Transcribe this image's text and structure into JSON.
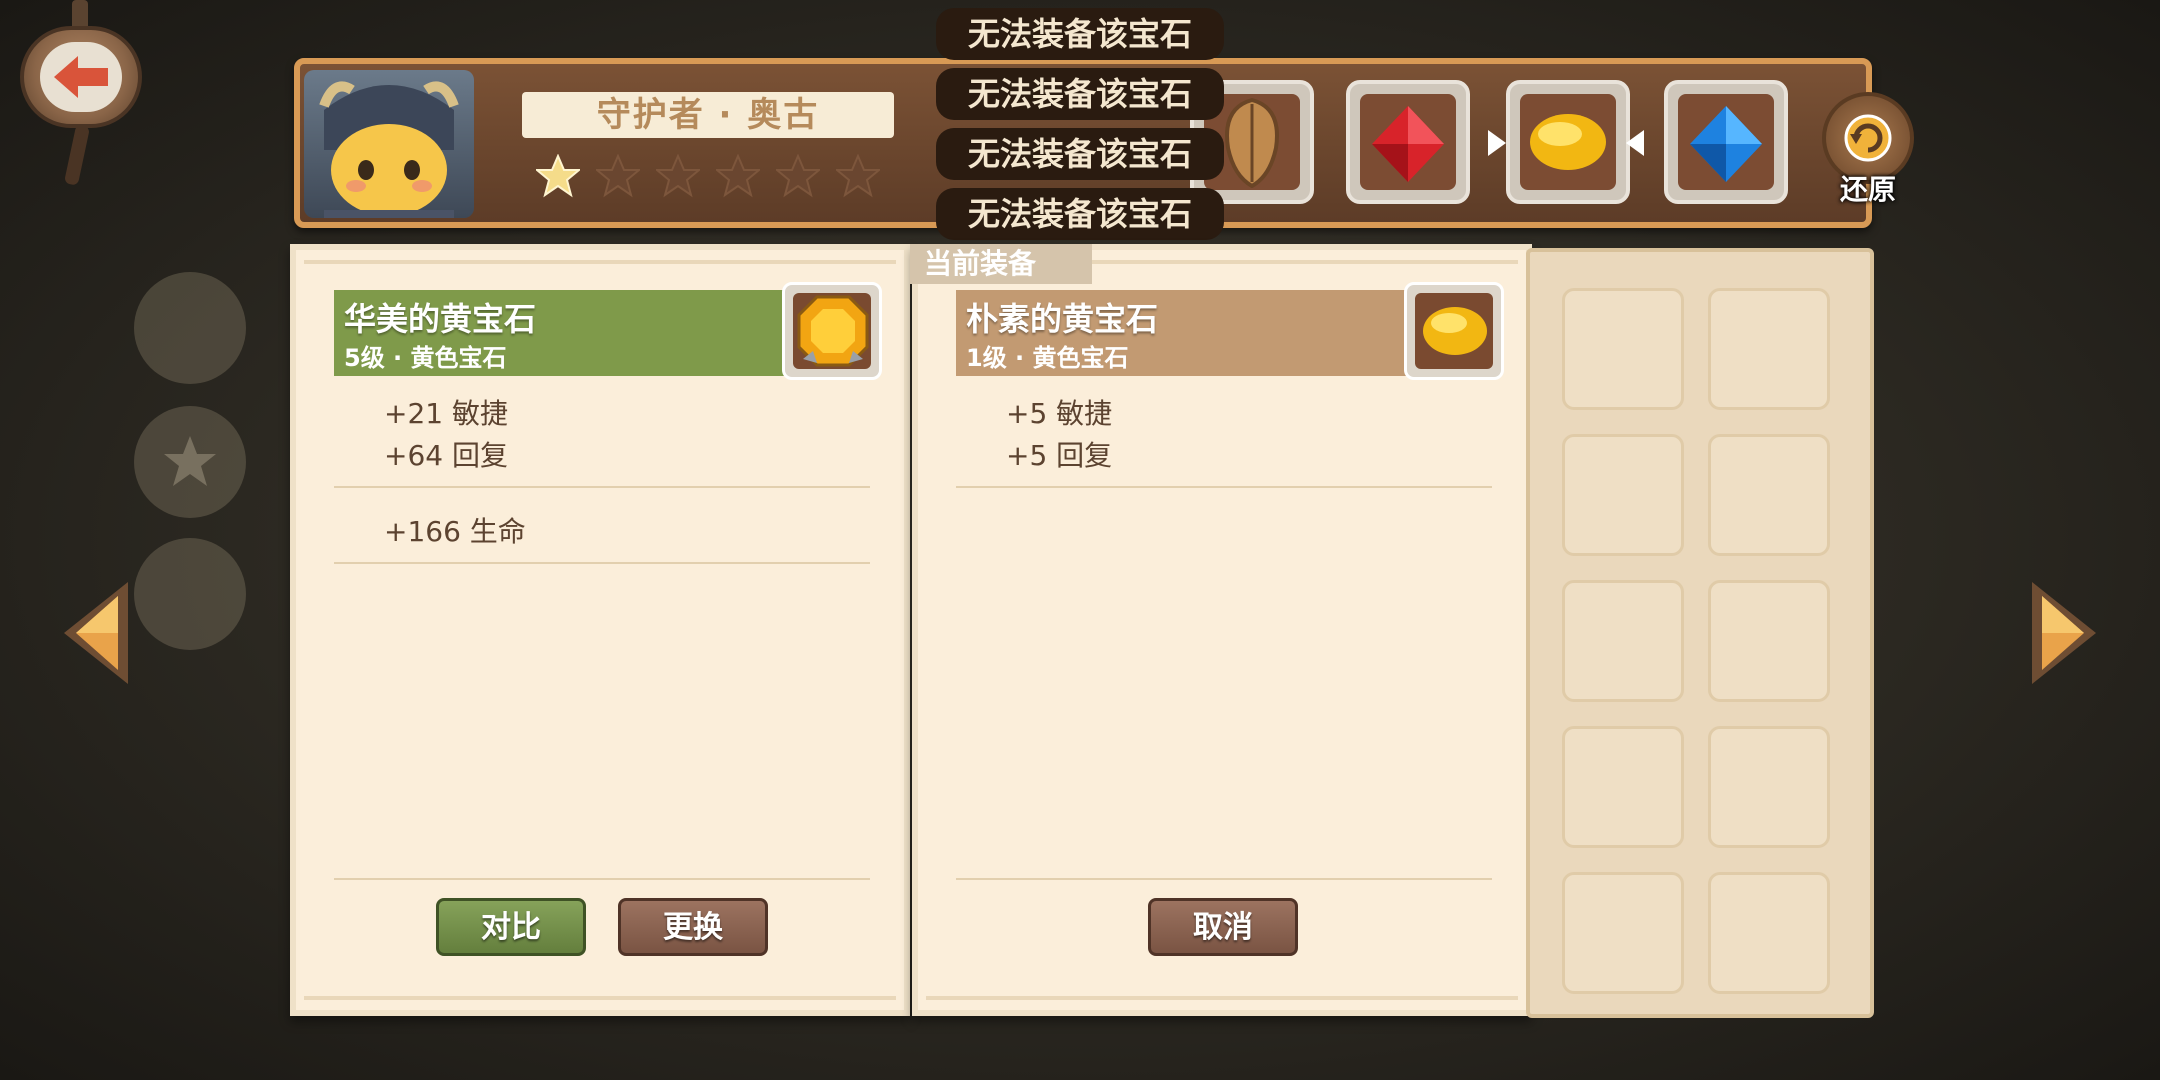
{
  "hero": {
    "name": "守护者 · 奥古",
    "stars_filled": 1,
    "stars_total": 6
  },
  "toasts": [
    "无法装备该宝石",
    "无法装备该宝石",
    "无法装备该宝石",
    "无法装备该宝石"
  ],
  "header": {
    "restore_label": "还原",
    "gem_slots": [
      "shield-icon",
      "red-gem-icon",
      "yellow-gem-icon",
      "blue-gem-icon"
    ]
  },
  "left_panel": {
    "name": "华美的黄宝石",
    "sub": "5级 · 黄色宝石",
    "banner_color": "#7f9a4a",
    "stats": [
      "+21  敏捷",
      "+64  回复"
    ],
    "extra_stats": [
      "+166  生命"
    ],
    "buttons": {
      "compare": "对比",
      "replace": "更换"
    }
  },
  "right_panel": {
    "tab": "当前装备",
    "name": "朴素的黄宝石",
    "sub": "1级 · 黄色宝石",
    "banner_color": "#c29a72",
    "stats": [
      "+5  敏捷",
      "+5  回复"
    ],
    "buttons": {
      "cancel": "取消"
    }
  },
  "colors": {
    "accent_orange": "#e8943a",
    "panel_bg": "#fbeeda"
  }
}
